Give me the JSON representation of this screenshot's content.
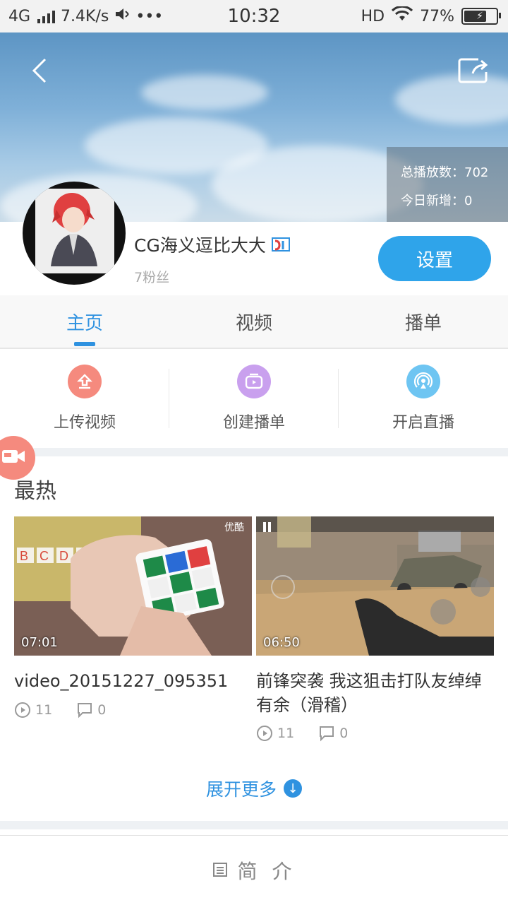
{
  "status_bar": {
    "network": "4G",
    "speed": "7.4K/s",
    "more": "•••",
    "time": "10:32",
    "hd": "HD",
    "battery": "77%",
    "battery_level": 0.77
  },
  "header": {
    "back_icon": "back-chevron-icon",
    "share_icon": "share-icon",
    "stats": {
      "total_plays": "总播放数：702",
      "today_new": "今日新增：0"
    }
  },
  "profile": {
    "username": "CG海义逗比大大",
    "fans": "7粉丝",
    "settings_label": "设置"
  },
  "tabs": [
    {
      "label": "主页"
    },
    {
      "label": "视频"
    },
    {
      "label": "播单"
    }
  ],
  "actions": [
    {
      "label": "上传视频",
      "icon": "upload-icon",
      "color": "#f58a7e"
    },
    {
      "label": "创建播单",
      "icon": "playlist-icon",
      "color": "#c9a0ee"
    },
    {
      "label": "开启直播",
      "icon": "live-icon",
      "color": "#6ec5f2"
    }
  ],
  "hot": {
    "title": "最热",
    "videos": [
      {
        "duration": "07:01",
        "title": "video_20151227_095351",
        "plays": "11",
        "comments": "0",
        "watermark": "优酷"
      },
      {
        "duration": "06:50",
        "title": "前锋突袭 我这狙击打队友绰绰有余（滑稽）",
        "plays": "11",
        "comments": "0"
      }
    ],
    "expand_label": "展开更多"
  },
  "intro": {
    "label": "简 介"
  },
  "colors": {
    "accent": "#2f92e0",
    "button": "#2fa4ea"
  }
}
